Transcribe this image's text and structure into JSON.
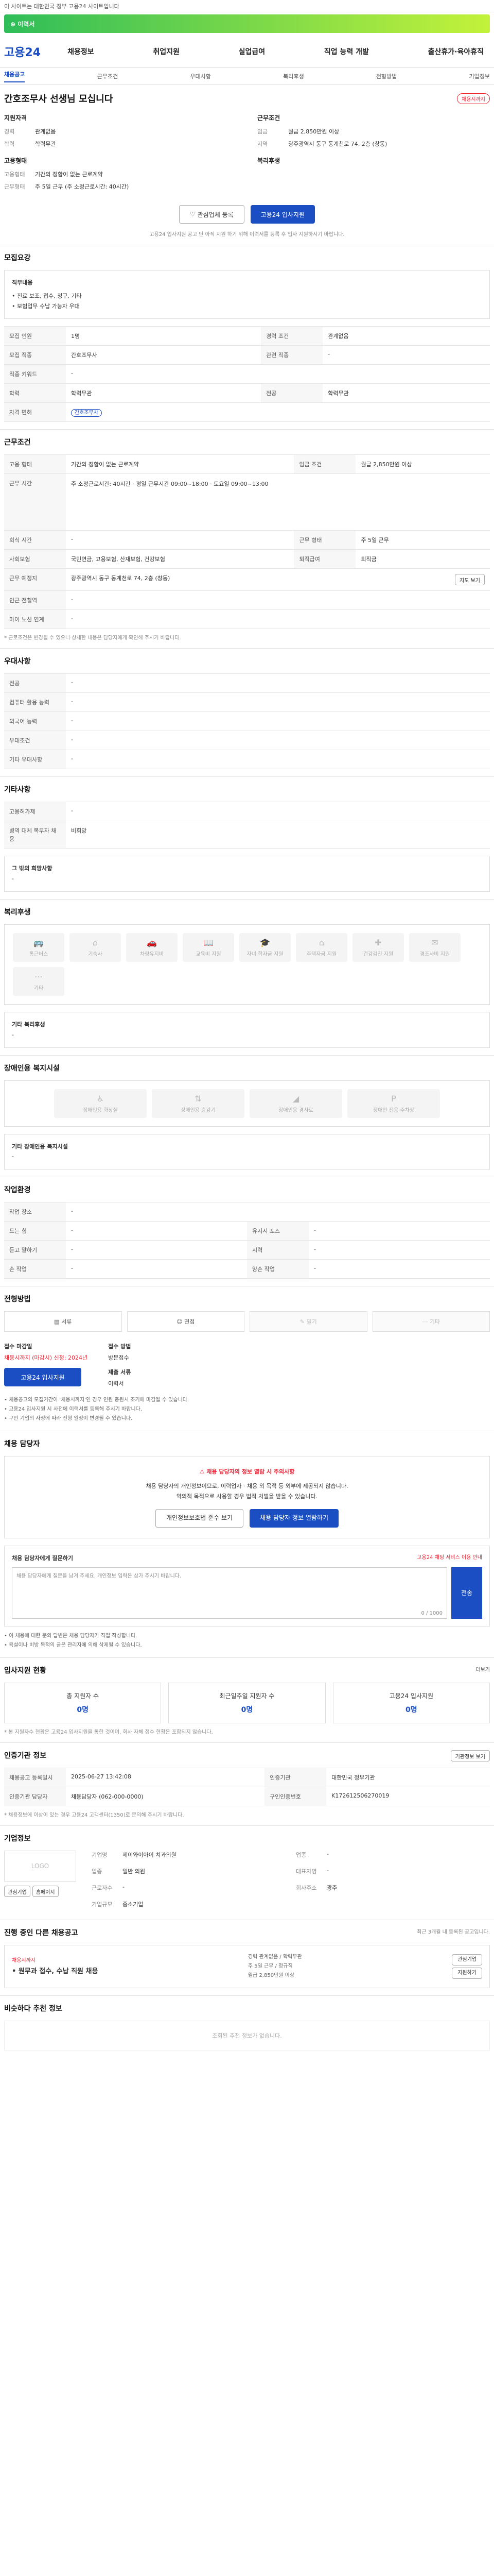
{
  "topbar": {
    "text": "이 사이트는 대한민국 정부 고용24 사이트입니다"
  },
  "banner": {
    "text": "⊕ 이력서"
  },
  "header": {
    "logo": "고용24",
    "gnb": [
      "채용정보",
      "취업지원",
      "실업급여",
      "직업 능력 개발",
      "출산휴가·육아휴직"
    ]
  },
  "subnav": [
    "채용공고",
    "근무조건",
    "우대사항",
    "복리후생",
    "전형방법",
    "기업정보"
  ],
  "job": {
    "title": "간호조무사 선생님 모십니다",
    "badge": "채용시까지",
    "qual_title": "지원자격",
    "exp_k": "경력",
    "exp_v": "관계없음",
    "edu_k": "학력",
    "edu_v": "학력무관",
    "cond_title": "근무조건",
    "region_k": "임금",
    "region_v": "월급 2,850만원 이상",
    "loc_k": "지역",
    "loc_v": "광주광역시 동구 동계천로 74, 2층 (창동)",
    "type_title": "고용형태",
    "type_k": "고용형태",
    "type_v": "기간의 정함이 없는 근로계약",
    "time_k": "근무형태",
    "time_v": "주 5일 근무 (주 소정근로시간: 40시간)",
    "welfare_title": "복리후생",
    "scrap_btn": "관심업체 등록",
    "apply_btn": "고용24 입사지원",
    "notice": "고용24 입사지원 공고 단 아직 지원 하기 위해 이력서를 등록 후 입사 지원하시기 바랍니다."
  },
  "sec_recruit": {
    "title": "모집요강",
    "box_label": "직무내용",
    "box_lines": [
      "• 진료 보조, 접수, 청구, 기타",
      "• 보험업무 수납 가능자 우대"
    ],
    "rows": [
      {
        "k": "모집 인원",
        "v": "1명",
        "k2": "경력 조건",
        "v2": "관계없음"
      },
      {
        "k": "모집 직종",
        "v": "간호조무사",
        "k2": "관련 직종",
        "v2": "-"
      },
      {
        "k": "직종 키워드",
        "v": "-",
        "k2": "",
        "v2": ""
      },
      {
        "k": "학력",
        "v": "학력무관",
        "k2": "전공",
        "v2": "학력무관"
      },
      {
        "k": "자격 면허",
        "v": "간호조무사",
        "k2": "",
        "v2": ""
      }
    ]
  },
  "sec_cond": {
    "title": "근무조건",
    "rows": [
      {
        "k": "고용 형태",
        "v": "기간의 정함이 없는 근로계약",
        "k2": "임금 조건",
        "v2": "월급 2,850만원 이상"
      },
      {
        "k": "근무 시간",
        "v": "주 소정근로시간: 40시간 · 평일 근무시간 09:00~18:00 · 토요일 09:00~13:00",
        "k2": "",
        "v2": ""
      },
      {
        "k": "회식 시간",
        "v": "-",
        "k2": "근무 형태",
        "v2": "주 5일 근무"
      },
      {
        "k": "사회보험",
        "v": "국민연금, 고용보험, 산재보험, 건강보험",
        "k2": "퇴직급여",
        "v2": "퇴직금"
      },
      {
        "k": "근무 예정지",
        "v": "광주광역시 동구 동계천로 74, 2층 (창동)",
        "k2": "",
        "v2": ""
      },
      {
        "k": "인근 전철역",
        "v": "-",
        "k2": "",
        "v2": ""
      },
      {
        "k": "마이 노선 연계",
        "v": "-",
        "k2": "",
        "v2": ""
      }
    ],
    "note": "* 근로조건은 변경될 수 있으니 상세한 내용은 담당자에게 확인해 주시기 바랍니다.",
    "map_btn": "지도 보기"
  },
  "sec_pref": {
    "title": "우대사항",
    "rows": [
      {
        "k": "전공",
        "v": "-"
      },
      {
        "k": "컴퓨터 활용 능력",
        "v": "-"
      },
      {
        "k": "외국어 능력",
        "v": "-"
      },
      {
        "k": "우대조건",
        "v": "-"
      },
      {
        "k": "기타 우대사항",
        "v": "-"
      }
    ]
  },
  "sec_etc": {
    "title": "기타사항",
    "rows": [
      {
        "k": "고용허가제",
        "v": "-"
      },
      {
        "k": "병역 대체 복무자 채용",
        "v": "비희망"
      }
    ],
    "box_label": "그 밖의 희망사항",
    "box_value": "-"
  },
  "sec_welfare": {
    "title": "복리후생",
    "items": [
      "통근버스",
      "기숙사",
      "차량유지비",
      "교육비 지원",
      "자녀 학자금 지원",
      "주택자금 지원",
      "건강검진 지원",
      "경조사비 지원",
      "기타"
    ],
    "box_label": "기타 복리후생",
    "box_value": "-"
  },
  "sec_disabled": {
    "title": "장애인용 복지시설",
    "items": [
      "장애인용 화장실",
      "장애인용 승강기",
      "장애인용 경사로",
      "장애인 전용 주차장"
    ],
    "box_label": "기타 장애인용 복지시설",
    "box_value": "-"
  },
  "sec_job_env": {
    "title": "작업환경",
    "rows": [
      {
        "k": "작업 장소",
        "v": "-",
        "k2": "",
        "v2": ""
      },
      {
        "k": "드는 힘",
        "v": "-",
        "k2": "유지시 포즈",
        "v2": "-"
      },
      {
        "k": "듣고 말하기",
        "v": "-",
        "k2": "시력",
        "v2": "-"
      },
      {
        "k": "손 작업",
        "v": "-",
        "k2": "양손 작업",
        "v2": "-"
      }
    ]
  },
  "sec_method": {
    "title": "전형방법",
    "methods": [
      {
        "label": "서류",
        "on": true
      },
      {
        "label": "면접",
        "on": true
      },
      {
        "label": "필기",
        "on": false
      },
      {
        "label": "기타",
        "on": false
      }
    ],
    "recv_k": "접수 마감일",
    "recv_v": "채용시까지 (마감시) 신청: 2024년",
    "recv2_k": "접수 방법",
    "recv2_v": "방문접수",
    "docs_k": "제출 서류",
    "docs_v": "이력서",
    "apply_btn": "고용24 입사지원",
    "notes": [
      "• 채용공고의 모집기간이 '채용시까지'인 경우 인원 충원시 조기에 마감될 수 있습니다.",
      "• 고용24 입사지원 시 사전에 이력서를 등록해 주시기 바랍니다.",
      "• 구인 기업의 사정에 따라 전형 일정이 변경될 수 있습니다."
    ]
  },
  "sec_contact": {
    "title": "채용 담당자",
    "warn_title": "채용 담당자의 정보 열람 시 주의사항",
    "warn_lines": [
      "채용 담당자의 개인정보이므로, 이력업자 · 채용 외 목적 등 외부에 제공되지 않습니다.",
      "악의적 목적으로 사용할 경우 법적 처벌을 받을 수 있습니다."
    ],
    "btn1": "개인정보보호법 준수 보기",
    "btn2": "채용 담당자 정보 열람하기",
    "msg_title": "채용 담당자에게 질문하기",
    "msg_link": "고용24 채팅 서비스 이용 안내",
    "msg_placeholder": "채용 담당자에게 질문을 남겨 주세요. 개인정보 입력은 삼가 주시기 바랍니다.",
    "msg_count": "0 / 1000",
    "send_btn": "전송",
    "notes": [
      "• 이 채용에 대한 문의 답변은 채용 담당자가 직접 작성합니다.",
      "• 욕설이나 비방 목적의 글은 관리자에 의해 삭제될 수 있습니다."
    ]
  },
  "sec_status": {
    "title": "입사지원 현황",
    "more": "더보기",
    "cards": [
      {
        "label": "총 지원자 수",
        "value": "0명"
      },
      {
        "label": "최근일주일 지원자 수",
        "value": "0명"
      },
      {
        "label": "고용24 입사지원",
        "value": "0명"
      }
    ],
    "note": "* 본 지원자수 현황은 고용24 입사지원을 통한 것이며, 회사 자체 접수 현황은 포함되지 않습니다."
  },
  "sec_info": {
    "title": "인증기관 정보",
    "btn": "기관정보 보기",
    "rows": [
      {
        "k": "채용공고 등록일시",
        "v": "2025-06-27 13:42:08",
        "k2": "인증기관",
        "v2": "대한민국 정부기관"
      },
      {
        "k": "인증기관 담당자",
        "v": "채용담당자 (062-000-0000)",
        "k2": "구인인증번호",
        "v2": "K172612506270019"
      }
    ],
    "note": "* 채용정보에 이상이 있는 경우 고용24 고객센터(1350)로 문의해 주시기 바랍니다."
  },
  "sec_company": {
    "title": "기업정보",
    "logo": "LOGO",
    "btn1": "관심기업",
    "btn2": "홈페이지",
    "rows": [
      {
        "k": "기업명",
        "v": "제이와이아이 치과의원",
        "k2": "업종",
        "v2": "-"
      },
      {
        "k": "업종",
        "v": "일반 의원",
        "k2": "대표자명",
        "v2": "-"
      },
      {
        "k": "근로자수",
        "v": "-",
        "k2": "회사주소",
        "v2": "광주"
      },
      {
        "k": "기업규모",
        "v": "중소기업",
        "k2": "",
        "v2": ""
      }
    ]
  },
  "sec_other": {
    "title": "진행 중인 다른 채용공고",
    "note": "최근 3개월 내 등록된 공고입니다.",
    "card_tag": "채용시까지",
    "card_title": "• 원무과 접수, 수납 직원 채용",
    "card_lines": [
      "경력 관계없음 / 학력무관",
      "주 5일 근무 / 정규직",
      "월급 2,850만원 이상"
    ],
    "btn1": "관심기업",
    "btn2": "지원하기"
  },
  "sec_similar": {
    "title": "비슷하다 추천 정보",
    "empty": "조회된 추천 정보가 없습니다."
  }
}
